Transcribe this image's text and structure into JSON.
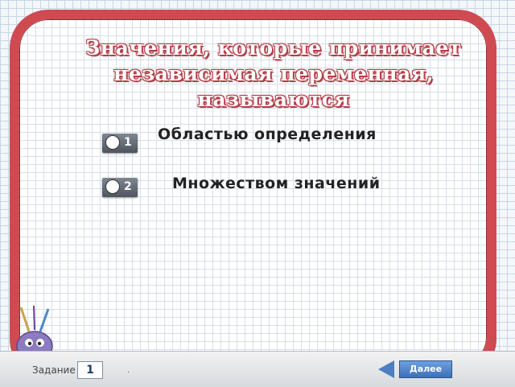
{
  "question": {
    "line1": "Значения, которые принимает",
    "line2": "независимая переменная,   называются"
  },
  "options": [
    {
      "number": "1",
      "text": "Областью определения"
    },
    {
      "number": "2",
      "text": "Множеством значений"
    }
  ],
  "footer": {
    "task_label": "Задание",
    "task_number": "1",
    "dot": ".",
    "next_label": "Далее"
  },
  "colors": {
    "frame": "#d04a52",
    "title_outline": "#b33d47",
    "button": "#4b7fc2"
  }
}
